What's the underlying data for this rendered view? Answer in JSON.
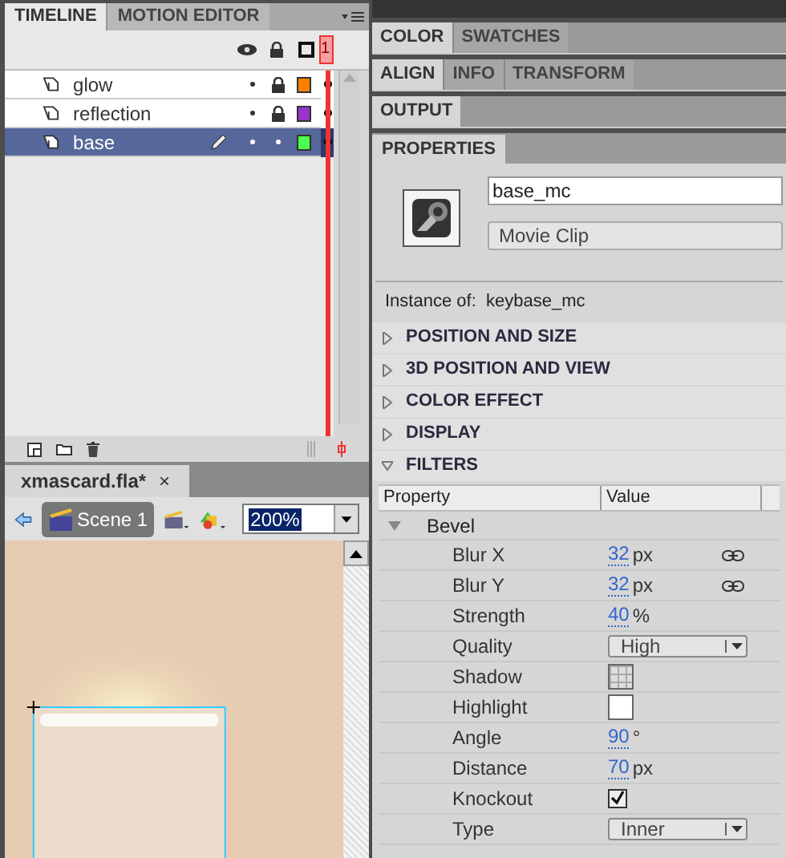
{
  "timeline": {
    "tabs": [
      {
        "label": "TIMELINE",
        "selected": true
      },
      {
        "label": "MOTION EDITOR",
        "selected": false
      }
    ],
    "frame_marker": "1",
    "layers": [
      {
        "name": "glow",
        "selected": false,
        "editing": false,
        "locked": true,
        "color": "#ff8000"
      },
      {
        "name": "reflection",
        "selected": false,
        "editing": false,
        "locked": true,
        "color": "#9933cc"
      },
      {
        "name": "base",
        "selected": true,
        "editing": true,
        "locked": false,
        "color": "#4cff4c"
      }
    ]
  },
  "document": {
    "tab": "xmascard.fla*",
    "close": "×",
    "scene": "Scene 1",
    "zoom": "200%"
  },
  "panel_groups": [
    {
      "tabs": [
        {
          "label": "COLOR",
          "selected": true
        },
        {
          "label": "SWATCHES",
          "selected": false
        }
      ]
    },
    {
      "tabs": [
        {
          "label": "ALIGN",
          "selected": true
        },
        {
          "label": "INFO",
          "selected": false
        },
        {
          "label": "TRANSFORM",
          "selected": false
        }
      ]
    },
    {
      "tabs": [
        {
          "label": "OUTPUT",
          "selected": true
        }
      ]
    }
  ],
  "properties": {
    "tab": "PROPERTIES",
    "instance_name": "base_mc",
    "symbol_type": "Movie Clip",
    "instance_of": "Instance of:  keybase_mc",
    "sections": [
      {
        "label": "POSITION AND SIZE",
        "expanded": false
      },
      {
        "label": "3D POSITION AND VIEW",
        "expanded": false
      },
      {
        "label": "COLOR EFFECT",
        "expanded": false
      },
      {
        "label": "DISPLAY",
        "expanded": false
      },
      {
        "label": "FILTERS",
        "expanded": true
      }
    ],
    "columns": [
      "Property",
      "Value"
    ],
    "filter": {
      "name": "Bevel",
      "expanded": true,
      "rows": [
        {
          "kind": "number",
          "label": "Blur X",
          "value": "32",
          "unit": "px",
          "linked": true
        },
        {
          "kind": "number",
          "label": "Blur Y",
          "value": "32",
          "unit": "px",
          "linked": true
        },
        {
          "kind": "number",
          "label": "Strength",
          "value": "40",
          "unit": "%"
        },
        {
          "kind": "select",
          "label": "Quality",
          "value": "High"
        },
        {
          "kind": "empty_swatch",
          "label": "Shadow"
        },
        {
          "kind": "swatch",
          "label": "Highlight",
          "color": "#ffffff"
        },
        {
          "kind": "number",
          "label": "Angle",
          "value": "90",
          "unit": "°"
        },
        {
          "kind": "number",
          "label": "Distance",
          "value": "70",
          "unit": "px"
        },
        {
          "kind": "checkbox",
          "label": "Knockout",
          "checked": true
        },
        {
          "kind": "select",
          "label": "Type",
          "value": "Inner"
        }
      ]
    }
  }
}
